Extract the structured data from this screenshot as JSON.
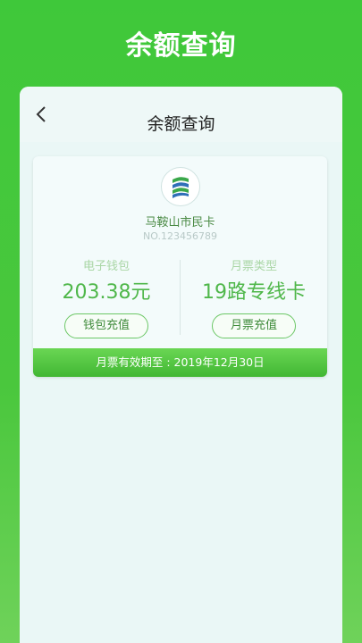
{
  "banner": {
    "title": "余额查询"
  },
  "header": {
    "title": "余额查询",
    "back_icon": "chevron-left-icon"
  },
  "card": {
    "name": "马鞍山市民卡",
    "number": "NO.123456789",
    "logo_icon": "city-card-logo"
  },
  "wallet": {
    "label": "电子钱包",
    "value": "203.38元",
    "button": "钱包充值"
  },
  "pass": {
    "label": "月票类型",
    "value": "19路专线卡",
    "button": "月票充值"
  },
  "validity": {
    "text": "月票有效期至 : 2019年12月30日"
  },
  "colors": {
    "accent": "#4fb74a",
    "banner": "#3fc83a"
  }
}
